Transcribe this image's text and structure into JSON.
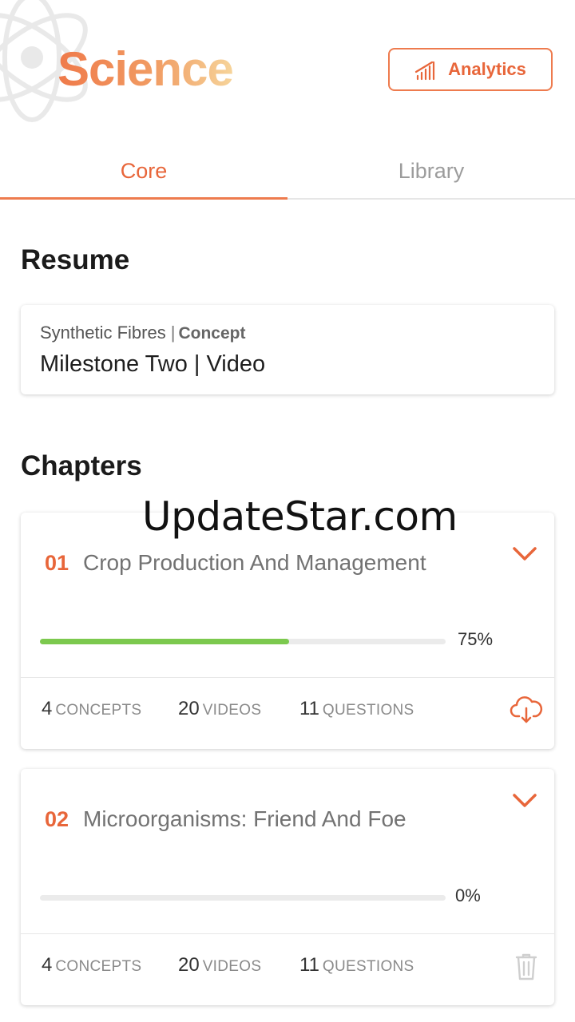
{
  "header": {
    "title": "Science",
    "analytics_label": "Analytics",
    "accent_color": "#e8663a"
  },
  "tabs": [
    {
      "label": "Core",
      "active": true
    },
    {
      "label": "Library",
      "active": false
    }
  ],
  "resume": {
    "section_title": "Resume",
    "chapter": "Synthetic Fibres",
    "separator": "|",
    "content_type": "Concept",
    "item": "Milestone Two | Video"
  },
  "chapters": {
    "section_title": "Chapters",
    "items": [
      {
        "number": "01",
        "title": "Crop Production And Management",
        "progress_percent": 75,
        "progress_label": "75%",
        "concepts_count": "4",
        "concepts_unit": "CONCEPTS",
        "videos_count": "20",
        "videos_unit": "VIDEOS",
        "questions_count": "11",
        "questions_unit": "QUESTIONS",
        "action_icon": "cloud-download-icon"
      },
      {
        "number": "02",
        "title": "Microorganisms: Friend And Foe",
        "progress_percent": 0,
        "progress_label": "0%",
        "concepts_count": "4",
        "concepts_unit": "CONCEPTS",
        "videos_count": "20",
        "videos_unit": "VIDEOS",
        "questions_count": "11",
        "questions_unit": "QUESTIONS",
        "action_icon": "trash-icon"
      }
    ]
  },
  "watermark": "UpdateStar.com"
}
